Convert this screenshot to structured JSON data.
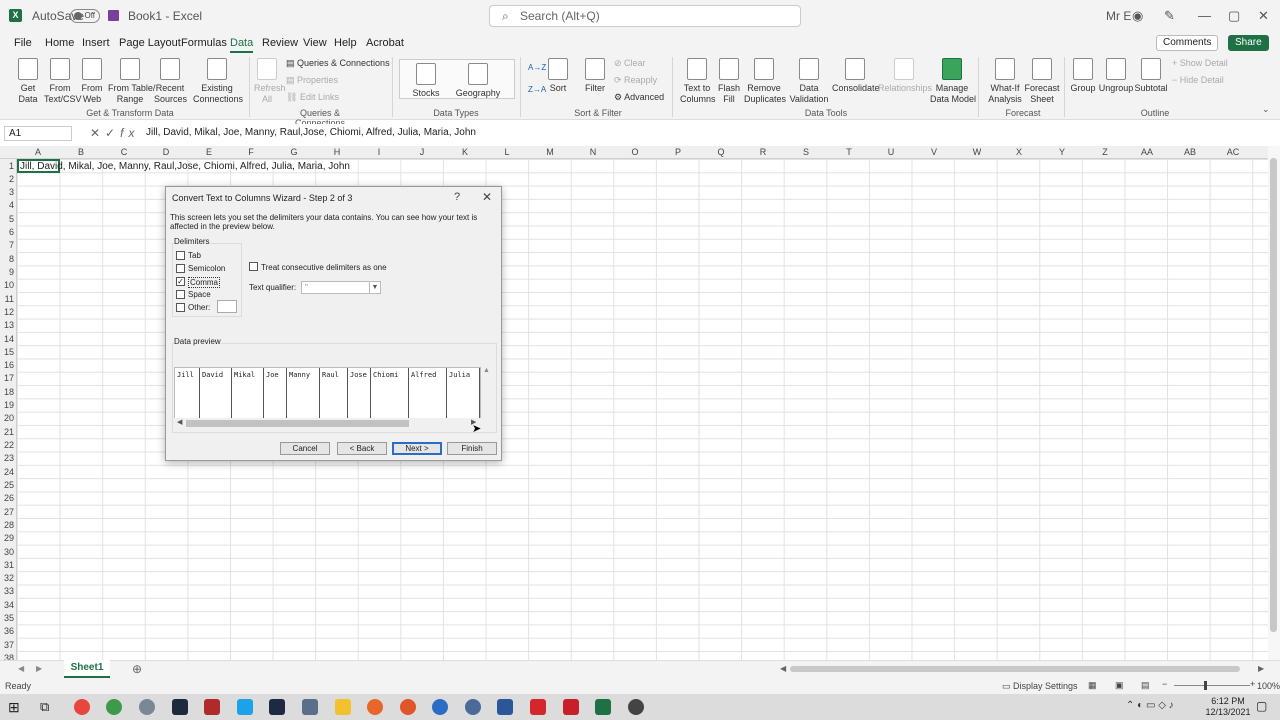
{
  "titlebar": {
    "autosave": "AutoSave",
    "toggle": "Off",
    "book": "Book1 - Excel",
    "search_placeholder": "Search (Alt+Q)",
    "user": "Mr E"
  },
  "menu": [
    "File",
    "Home",
    "Insert",
    "Page Layout",
    "Formulas",
    "Data",
    "Review",
    "View",
    "Help",
    "Acrobat"
  ],
  "active_menu": "Data",
  "comments": "Comments",
  "share": "Share",
  "ribbon": {
    "get_data": "Get\nData",
    "from_text": "From\nText/CSV",
    "from_web": "From\nWeb",
    "from_table": "From Table/\nRange",
    "recent_sources": "Recent\nSources",
    "existing_connections": "Existing\nConnections",
    "refresh_all": "Refresh\nAll",
    "queries_connections": "Queries & Connections",
    "properties": "Properties",
    "edit_links": "Edit Links",
    "stocks": "Stocks",
    "geography": "Geography",
    "sort_az": "A→Z",
    "sort_za": "Z→A",
    "sort": "Sort",
    "filter": "Filter",
    "clear": "Clear",
    "reapply": "Reapply",
    "advanced": "Advanced",
    "text_to_columns": "Text to\nColumns",
    "flash_fill": "Flash\nFill",
    "remove_duplicates": "Remove\nDuplicates",
    "data_validation": "Data\nValidation",
    "consolidate": "Consolidate",
    "relationships": "Relationships",
    "manage_data_model": "Manage\nData Model",
    "what_if": "What-If\nAnalysis",
    "forecast_sheet": "Forecast\nSheet",
    "group": "Group",
    "ungroup": "Ungroup",
    "subtotal": "Subtotal",
    "show_detail": "Show Detail",
    "hide_detail": "Hide Detail",
    "groups": [
      "Get & Transform Data",
      "Queries & Connections",
      "Data Types",
      "Sort & Filter",
      "Data Tools",
      "Forecast",
      "Outline"
    ]
  },
  "namebox": "A1",
  "formula": "Jill, David, Mikal, Joe, Manny, Raul,Jose, Chiomi, Alfred, Julia, Maria, John",
  "columns": [
    "A",
    "B",
    "C",
    "D",
    "E",
    "F",
    "G",
    "H",
    "I",
    "J",
    "K",
    "L",
    "M",
    "N",
    "O",
    "P",
    "Q",
    "R",
    "S",
    "T",
    "U",
    "V",
    "W",
    "X",
    "Y",
    "Z",
    "AA",
    "AB",
    "AC"
  ],
  "rows": [
    "1",
    "2",
    "3",
    "4",
    "5",
    "6",
    "7",
    "8",
    "9",
    "10",
    "11",
    "12",
    "13",
    "14",
    "15",
    "16",
    "17",
    "18",
    "19",
    "20",
    "21",
    "22",
    "23",
    "24",
    "25",
    "26",
    "27",
    "28",
    "29",
    "30",
    "31",
    "32",
    "33",
    "34",
    "35",
    "36",
    "37",
    "38"
  ],
  "cell_a1": "Jill, David, Mikal, Joe, Manny, Raul,Jose, Chiomi, Alfred, Julia, Maria, John",
  "dialog": {
    "title": "Convert Text to Columns Wizard - Step 2 of 3",
    "help": "?",
    "close": "✕",
    "description": "This screen lets you set the delimiters your data contains.  You can see how your text is affected in the preview below.",
    "delimiters_label": "Delimiters",
    "tab": "Tab",
    "semicolon": "Semicolon",
    "comma": "Comma",
    "space": "Space",
    "other": "Other:",
    "consecutive": "Treat consecutive delimiters as one",
    "qualifier_label": "Text qualifier:",
    "qualifier_value": "\"",
    "preview_label": "Data preview",
    "preview_cols": [
      "Jill",
      "David",
      "Mikal",
      "Joe",
      "Manny",
      "Raul",
      "Jose",
      "Chiomi",
      "Alfred",
      "Julia"
    ],
    "cancel": "Cancel",
    "back": "< Back",
    "next": "Next >",
    "finish": "Finish"
  },
  "sheet_tab": "Sheet1",
  "status": "Ready",
  "display_settings": "Display Settings",
  "zoom": "100%",
  "clock": {
    "time": "6:12 PM",
    "date": "12/13/2021"
  },
  "colors": {
    "excel_green": "#1e7145",
    "accent_blue": "#2a6cc7"
  }
}
